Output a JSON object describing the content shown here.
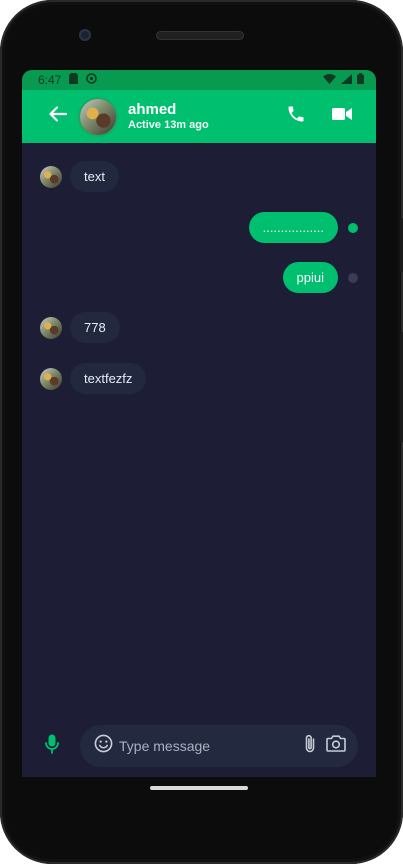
{
  "status_bar": {
    "time": "6:47"
  },
  "header": {
    "contact_name": "ahmed",
    "contact_status": "Active 13m ago"
  },
  "messages": [
    {
      "direction": "in",
      "text": "text"
    },
    {
      "direction": "out",
      "text": ".................",
      "receipt": "seen"
    },
    {
      "direction": "out",
      "text": "ppiui",
      "receipt": "sent"
    },
    {
      "direction": "in",
      "text": "778"
    },
    {
      "direction": "in",
      "text": "textfezfz"
    }
  ],
  "composer": {
    "placeholder": "Type message"
  },
  "colors": {
    "accent": "#00bf6f",
    "status_bar": "#099a52",
    "background": "#1d1d36",
    "incoming_bubble": "#22283d",
    "input_field": "#232a40"
  },
  "icons": {
    "back": "arrow-left-icon",
    "call": "phone-icon",
    "video": "video-camera-icon",
    "mic": "microphone-icon",
    "emoji": "smiley-icon",
    "attach": "paperclip-icon",
    "camera": "camera-icon"
  }
}
